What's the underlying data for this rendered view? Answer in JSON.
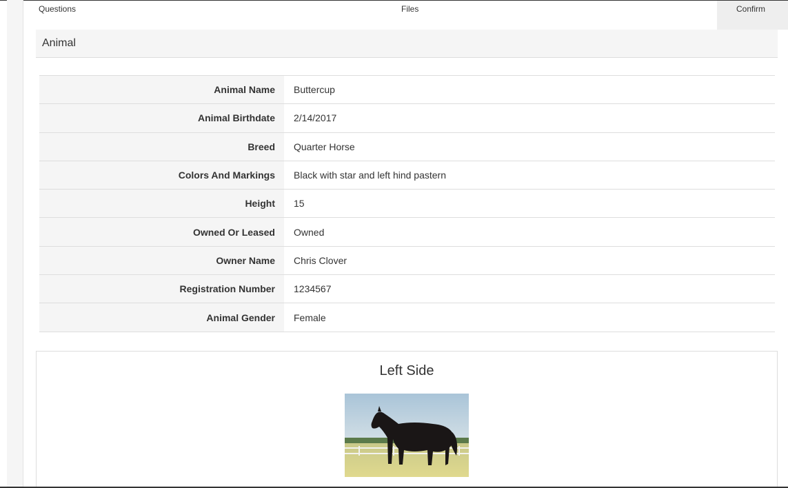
{
  "steps": [
    {
      "label": "Questions"
    },
    {
      "label": "Files"
    },
    {
      "label": "Confirm"
    }
  ],
  "section": {
    "title": "Animal"
  },
  "details": [
    {
      "label": "Animal Name",
      "value": "Buttercup"
    },
    {
      "label": "Animal Birthdate",
      "value": "2/14/2017"
    },
    {
      "label": "Breed",
      "value": "Quarter Horse"
    },
    {
      "label": "Colors And Markings",
      "value": "Black with star and left hind pastern"
    },
    {
      "label": "Height",
      "value": "15"
    },
    {
      "label": "Owned Or Leased",
      "value": "Owned"
    },
    {
      "label": "Owner Name",
      "value": "Chris Clover"
    },
    {
      "label": "Registration Number",
      "value": "1234567"
    },
    {
      "label": "Animal Gender",
      "value": "Female"
    }
  ],
  "photo": {
    "title": "Left Side"
  },
  "colors": {
    "active_step_bg": "#eeeeee",
    "label_bg": "#f5f5f5",
    "border": "#dddddd",
    "text": "#333333"
  }
}
